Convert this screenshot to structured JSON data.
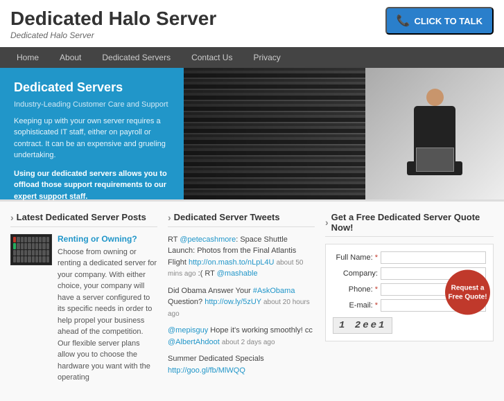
{
  "header": {
    "site_title": "Dedicated Halo Server",
    "site_subtitle": "Dedicated Halo Server",
    "cta_label": "CLICK TO TALK"
  },
  "nav": {
    "items": [
      {
        "label": "Home",
        "active": false
      },
      {
        "label": "About",
        "active": false
      },
      {
        "label": "Dedicated Servers",
        "active": false
      },
      {
        "label": "Contact Us",
        "active": false
      },
      {
        "label": "Privacy",
        "active": false
      }
    ]
  },
  "hero": {
    "title": "Dedicated Servers",
    "subtitle": "Industry-Leading Customer Care and Support",
    "body1": "Keeping up with your own server requires a sophisticated IT staff, either on payroll or contract. It can be an expensive and grueling undertaking.",
    "highlight": "Using our dedicated servers allows you to offload those support requirements to our expert support staff."
  },
  "latest_posts": {
    "section_title": "Latest Dedicated Server Posts",
    "post": {
      "title": "Renting or Owning?",
      "body": "Choose from owning or renting a dedicated server for your company. With either choice, your company will have a server configured to its specific needs in order to help propel your business ahead of the competition. Our flexible server plans allow you to choose the hardware you want with the operating"
    }
  },
  "tweets": {
    "section_title": "Dedicated Server Tweets",
    "items": [
      {
        "text": "RT @petecashmore: Space Shuttle Launch: Photos from the Final Atlantis Flight ",
        "link": "http://on.mash.to/nLpL4U",
        "time": "about 50 mins ago",
        "suffix": ":( RT @mashable"
      },
      {
        "text": "Did Obama Answer Your #AskObama Question? ",
        "link": "http://ow.ly/5zUY",
        "time": "about 20 hours ago"
      },
      {
        "text": "@mepisguy Hope it's working smoothly! cc @AlbertAhdoot ",
        "time": "about 2 days ago"
      },
      {
        "text": "Summer Dedicated Specials ",
        "link": "http://goo.gl/fb/MlWQQ"
      }
    ]
  },
  "quote_form": {
    "section_title": "Get a Free Dedicated Server Quote Now!",
    "fields": [
      {
        "label": "Full Name:",
        "required": true,
        "name": "full-name"
      },
      {
        "label": "Company:",
        "required": false,
        "name": "company"
      },
      {
        "label": "Phone:",
        "required": true,
        "name": "phone"
      },
      {
        "label": "E-mail:",
        "required": true,
        "name": "email"
      }
    ],
    "captcha": "1 2ee1",
    "button_label": "Request a Free Quote!"
  }
}
